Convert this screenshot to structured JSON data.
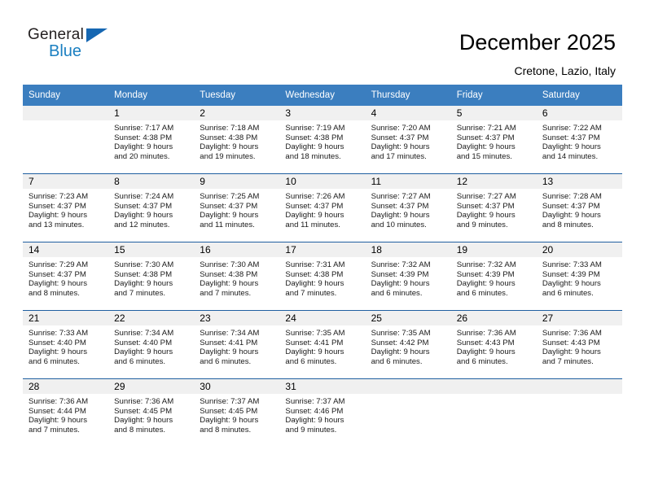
{
  "brand": {
    "name_top": "General",
    "name_bottom": "Blue",
    "triangle_icon": "brand-triangle-icon",
    "accent_color": "#1a7fc1"
  },
  "header": {
    "title": "December 2025",
    "location": "Cretone, Lazio, Italy"
  },
  "calendar": {
    "header_bg": "#3b7ebf",
    "row_border_color": "#1f5fa0",
    "daynum_band_bg": "#f0f0f0",
    "weekdays": [
      "Sunday",
      "Monday",
      "Tuesday",
      "Wednesday",
      "Thursday",
      "Friday",
      "Saturday"
    ],
    "weeks": [
      [
        {
          "day": "",
          "sunrise": "",
          "sunset": "",
          "daylight_line1": "",
          "daylight_line2": "",
          "empty": true
        },
        {
          "day": "1",
          "sunrise": "Sunrise: 7:17 AM",
          "sunset": "Sunset: 4:38 PM",
          "daylight_line1": "Daylight: 9 hours",
          "daylight_line2": "and 20 minutes."
        },
        {
          "day": "2",
          "sunrise": "Sunrise: 7:18 AM",
          "sunset": "Sunset: 4:38 PM",
          "daylight_line1": "Daylight: 9 hours",
          "daylight_line2": "and 19 minutes."
        },
        {
          "day": "3",
          "sunrise": "Sunrise: 7:19 AM",
          "sunset": "Sunset: 4:38 PM",
          "daylight_line1": "Daylight: 9 hours",
          "daylight_line2": "and 18 minutes."
        },
        {
          "day": "4",
          "sunrise": "Sunrise: 7:20 AM",
          "sunset": "Sunset: 4:37 PM",
          "daylight_line1": "Daylight: 9 hours",
          "daylight_line2": "and 17 minutes."
        },
        {
          "day": "5",
          "sunrise": "Sunrise: 7:21 AM",
          "sunset": "Sunset: 4:37 PM",
          "daylight_line1": "Daylight: 9 hours",
          "daylight_line2": "and 15 minutes."
        },
        {
          "day": "6",
          "sunrise": "Sunrise: 7:22 AM",
          "sunset": "Sunset: 4:37 PM",
          "daylight_line1": "Daylight: 9 hours",
          "daylight_line2": "and 14 minutes."
        }
      ],
      [
        {
          "day": "7",
          "sunrise": "Sunrise: 7:23 AM",
          "sunset": "Sunset: 4:37 PM",
          "daylight_line1": "Daylight: 9 hours",
          "daylight_line2": "and 13 minutes."
        },
        {
          "day": "8",
          "sunrise": "Sunrise: 7:24 AM",
          "sunset": "Sunset: 4:37 PM",
          "daylight_line1": "Daylight: 9 hours",
          "daylight_line2": "and 12 minutes."
        },
        {
          "day": "9",
          "sunrise": "Sunrise: 7:25 AM",
          "sunset": "Sunset: 4:37 PM",
          "daylight_line1": "Daylight: 9 hours",
          "daylight_line2": "and 11 minutes."
        },
        {
          "day": "10",
          "sunrise": "Sunrise: 7:26 AM",
          "sunset": "Sunset: 4:37 PM",
          "daylight_line1": "Daylight: 9 hours",
          "daylight_line2": "and 11 minutes."
        },
        {
          "day": "11",
          "sunrise": "Sunrise: 7:27 AM",
          "sunset": "Sunset: 4:37 PM",
          "daylight_line1": "Daylight: 9 hours",
          "daylight_line2": "and 10 minutes."
        },
        {
          "day": "12",
          "sunrise": "Sunrise: 7:27 AM",
          "sunset": "Sunset: 4:37 PM",
          "daylight_line1": "Daylight: 9 hours",
          "daylight_line2": "and 9 minutes."
        },
        {
          "day": "13",
          "sunrise": "Sunrise: 7:28 AM",
          "sunset": "Sunset: 4:37 PM",
          "daylight_line1": "Daylight: 9 hours",
          "daylight_line2": "and 8 minutes."
        }
      ],
      [
        {
          "day": "14",
          "sunrise": "Sunrise: 7:29 AM",
          "sunset": "Sunset: 4:37 PM",
          "daylight_line1": "Daylight: 9 hours",
          "daylight_line2": "and 8 minutes."
        },
        {
          "day": "15",
          "sunrise": "Sunrise: 7:30 AM",
          "sunset": "Sunset: 4:38 PM",
          "daylight_line1": "Daylight: 9 hours",
          "daylight_line2": "and 7 minutes."
        },
        {
          "day": "16",
          "sunrise": "Sunrise: 7:30 AM",
          "sunset": "Sunset: 4:38 PM",
          "daylight_line1": "Daylight: 9 hours",
          "daylight_line2": "and 7 minutes."
        },
        {
          "day": "17",
          "sunrise": "Sunrise: 7:31 AM",
          "sunset": "Sunset: 4:38 PM",
          "daylight_line1": "Daylight: 9 hours",
          "daylight_line2": "and 7 minutes."
        },
        {
          "day": "18",
          "sunrise": "Sunrise: 7:32 AM",
          "sunset": "Sunset: 4:39 PM",
          "daylight_line1": "Daylight: 9 hours",
          "daylight_line2": "and 6 minutes."
        },
        {
          "day": "19",
          "sunrise": "Sunrise: 7:32 AM",
          "sunset": "Sunset: 4:39 PM",
          "daylight_line1": "Daylight: 9 hours",
          "daylight_line2": "and 6 minutes."
        },
        {
          "day": "20",
          "sunrise": "Sunrise: 7:33 AM",
          "sunset": "Sunset: 4:39 PM",
          "daylight_line1": "Daylight: 9 hours",
          "daylight_line2": "and 6 minutes."
        }
      ],
      [
        {
          "day": "21",
          "sunrise": "Sunrise: 7:33 AM",
          "sunset": "Sunset: 4:40 PM",
          "daylight_line1": "Daylight: 9 hours",
          "daylight_line2": "and 6 minutes."
        },
        {
          "day": "22",
          "sunrise": "Sunrise: 7:34 AM",
          "sunset": "Sunset: 4:40 PM",
          "daylight_line1": "Daylight: 9 hours",
          "daylight_line2": "and 6 minutes."
        },
        {
          "day": "23",
          "sunrise": "Sunrise: 7:34 AM",
          "sunset": "Sunset: 4:41 PM",
          "daylight_line1": "Daylight: 9 hours",
          "daylight_line2": "and 6 minutes."
        },
        {
          "day": "24",
          "sunrise": "Sunrise: 7:35 AM",
          "sunset": "Sunset: 4:41 PM",
          "daylight_line1": "Daylight: 9 hours",
          "daylight_line2": "and 6 minutes."
        },
        {
          "day": "25",
          "sunrise": "Sunrise: 7:35 AM",
          "sunset": "Sunset: 4:42 PM",
          "daylight_line1": "Daylight: 9 hours",
          "daylight_line2": "and 6 minutes."
        },
        {
          "day": "26",
          "sunrise": "Sunrise: 7:36 AM",
          "sunset": "Sunset: 4:43 PM",
          "daylight_line1": "Daylight: 9 hours",
          "daylight_line2": "and 6 minutes."
        },
        {
          "day": "27",
          "sunrise": "Sunrise: 7:36 AM",
          "sunset": "Sunset: 4:43 PM",
          "daylight_line1": "Daylight: 9 hours",
          "daylight_line2": "and 7 minutes."
        }
      ],
      [
        {
          "day": "28",
          "sunrise": "Sunrise: 7:36 AM",
          "sunset": "Sunset: 4:44 PM",
          "daylight_line1": "Daylight: 9 hours",
          "daylight_line2": "and 7 minutes."
        },
        {
          "day": "29",
          "sunrise": "Sunrise: 7:36 AM",
          "sunset": "Sunset: 4:45 PM",
          "daylight_line1": "Daylight: 9 hours",
          "daylight_line2": "and 8 minutes."
        },
        {
          "day": "30",
          "sunrise": "Sunrise: 7:37 AM",
          "sunset": "Sunset: 4:45 PM",
          "daylight_line1": "Daylight: 9 hours",
          "daylight_line2": "and 8 minutes."
        },
        {
          "day": "31",
          "sunrise": "Sunrise: 7:37 AM",
          "sunset": "Sunset: 4:46 PM",
          "daylight_line1": "Daylight: 9 hours",
          "daylight_line2": "and 9 minutes."
        },
        {
          "day": "",
          "sunrise": "",
          "sunset": "",
          "daylight_line1": "",
          "daylight_line2": "",
          "empty": true
        },
        {
          "day": "",
          "sunrise": "",
          "sunset": "",
          "daylight_line1": "",
          "daylight_line2": "",
          "empty": true
        },
        {
          "day": "",
          "sunrise": "",
          "sunset": "",
          "daylight_line1": "",
          "daylight_line2": "",
          "empty": true
        }
      ]
    ]
  }
}
